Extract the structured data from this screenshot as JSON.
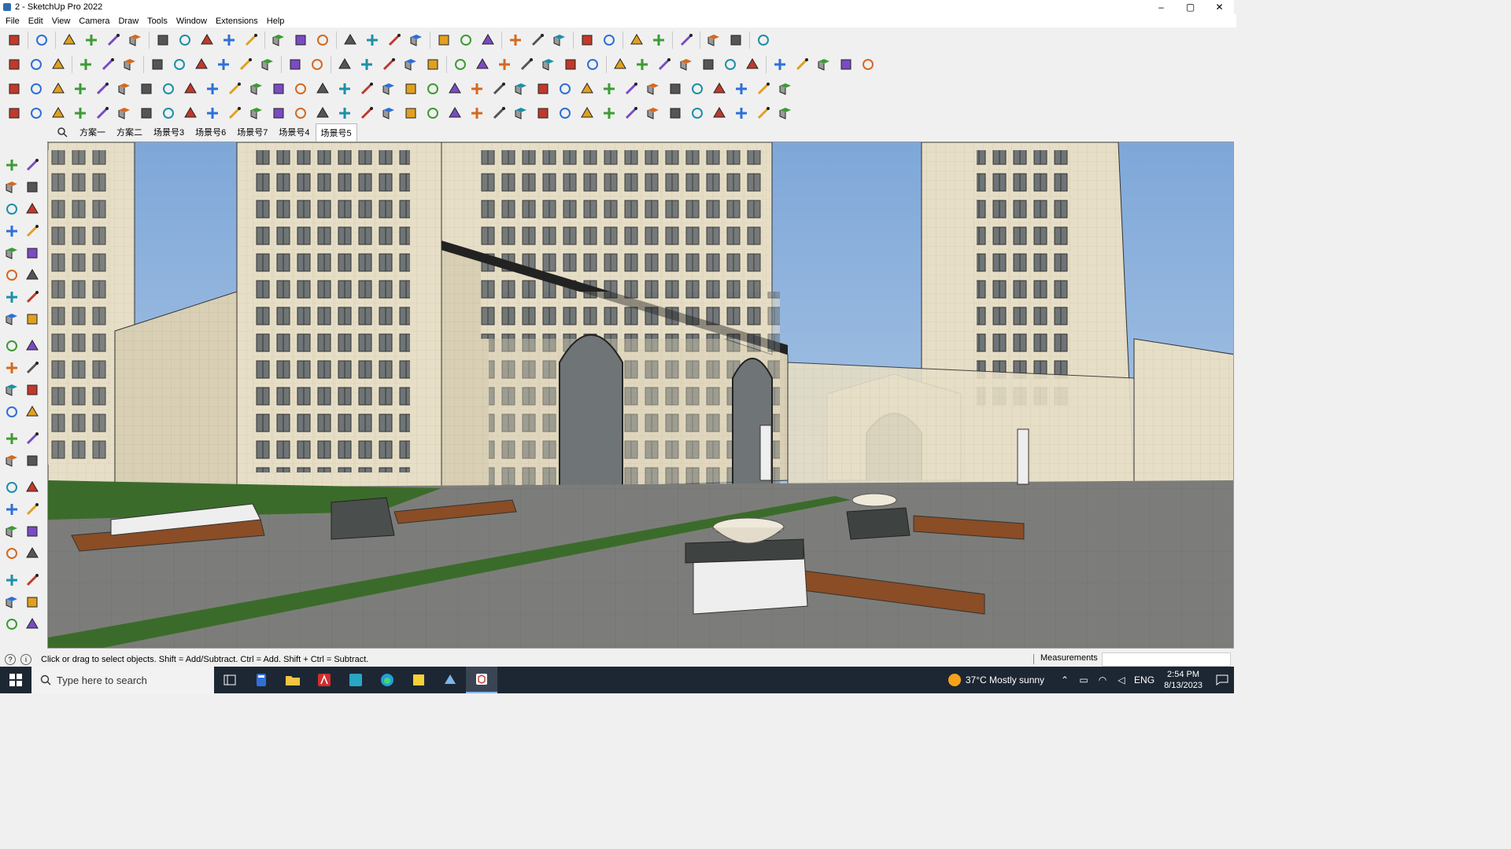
{
  "window": {
    "title": "2 - SketchUp Pro 2022",
    "controls": [
      "–",
      "▢",
      "✕"
    ]
  },
  "menu": [
    "File",
    "Edit",
    "View",
    "Camera",
    "Draw",
    "Tools",
    "Window",
    "Extensions",
    "Help"
  ],
  "scenes": {
    "tabs": [
      "方案一",
      "方案二",
      "场景号3",
      "场景号6",
      "场景号7",
      "场景号4",
      "场景号5"
    ],
    "active_index": 6
  },
  "status": {
    "hint": "Click or drag to select objects. Shift = Add/Subtract. Ctrl = Add. Shift + Ctrl = Subtract.",
    "measurements_label": "Measurements",
    "measurements_value": ""
  },
  "taskbar": {
    "search_placeholder": "Type here to search",
    "weather": "37°C  Mostly sunny",
    "language": "ENG",
    "time": "2:54 PM",
    "date": "8/13/2023"
  },
  "icon_sets": {
    "row1": [
      "search-icon",
      "select-icon",
      "eraser-icon",
      "line-icon",
      "freehand-icon",
      "rectangle-icon",
      "push-pull-icon",
      "follow-me-icon",
      "move-icon",
      "rotate-icon",
      "scale-icon",
      "tape-measure-icon",
      "text-icon",
      "paint-bucket-icon",
      "orbit-icon",
      "pan-icon",
      "zoom-icon",
      "zoom-extents-icon",
      "components-icon",
      "layers-icon",
      "styles-icon",
      "account-icon",
      "warehouse-icon",
      "extension-icon",
      "share-icon",
      "upload-icon",
      "download-icon",
      "dimension-icon",
      "section-icon",
      "undo-icon",
      "redo-icon",
      "trimble-icon"
    ],
    "row2": [
      "iso-view-icon",
      "top-view-icon",
      "front-view-icon",
      "right-view-icon",
      "back-view-icon",
      "left-view-icon",
      "wireframe-icon",
      "hidden-line-icon",
      "shaded-icon",
      "textured-icon",
      "monochrome-icon",
      "xray-icon",
      "section-plane-icon",
      "display-section-icon",
      "house-icon",
      "shed-icon",
      "home-icon",
      "outline-icon",
      "roof-icon",
      "solid-tools-icon",
      "union-icon",
      "subtract-icon",
      "trim-icon",
      "intersect-icon",
      "split-icon",
      "outer-shell-icon",
      "circle-icon",
      "polygon-icon",
      "arc-icon",
      "pie-icon",
      "offset-icon",
      "sandbox-icon",
      "contour-icon",
      "smoove-icon",
      "stamp-icon",
      "drape-icon",
      "add-detail-icon",
      "flip-edge-icon"
    ],
    "row3": [
      "plane-blue-icon",
      "plane-cyan-icon",
      "plane-yellow-icon",
      "plane-green-icon",
      "plane-red-icon",
      "plane-gray-icon",
      "loop-icon",
      "square-red-icon",
      "stairs-icon",
      "cube-small-icon",
      "chain-icon",
      "curve-icon",
      "nodes-icon",
      "cross-red-icon",
      "cross-green-icon",
      "cross-blue-icon",
      "cone-icon",
      "pyramid-icon",
      "warning-icon",
      "arc-tool-icon",
      "spiral-icon",
      "rotate-copy-icon",
      "array-icon",
      "box-icon",
      "undo-red-icon",
      "grid-green-icon",
      "knot-icon",
      "camera-icon",
      "gem-icon",
      "cog-icon",
      "bridge-icon",
      "tiles-icon",
      "frame-icon",
      "cross-dots-icon",
      "circle-dots-icon",
      "grid-icon"
    ],
    "row4": [
      "path-icon",
      "bezier-icon",
      "paint-roller-icon",
      "scissors-icon",
      "gear-icon",
      "layers-stack-icon",
      "torus-icon",
      "spring-icon",
      "corner-icon",
      "corner-alt-icon",
      "knife-icon",
      "fillet-icon",
      "column-icon",
      "colonnade-icon",
      "dome-icon",
      "vault-icon",
      "arch-icon",
      "roof-slope-icon",
      "stair-icon",
      "bench-icon",
      "truss-icon",
      "rail-icon",
      "fence-icon",
      "ramp-icon",
      "pillar-icon",
      "panel-icon",
      "wall-icon",
      "facade-icon",
      "grid-panel-icon",
      "lattice-icon",
      "slats-icon",
      "wheel-icon",
      "sunburst-icon",
      "louvre-icon",
      "fan-icon",
      "house-outline-icon"
    ],
    "left": [
      "select-arrow-icon",
      "orbit-icon",
      "paint-bucket-icon",
      "eraser-icon",
      "components-icon",
      "tape-measure-icon",
      "line-icon",
      "freehand-icon",
      "rectangle-icon",
      "rotated-rectangle-icon",
      "circle-icon",
      "polygon-icon",
      "arc-icon",
      "two-point-arc-icon",
      "three-point-arc-icon",
      "pie-icon",
      "move-icon",
      "push-pull-icon",
      "rotate-icon",
      "follow-me-icon",
      "scale-icon",
      "offset-icon",
      "tape-measure-icon",
      "dimension-icon",
      "protractor-icon",
      "text-icon",
      "axes-icon",
      "3d-text-icon",
      "orbit-tool-icon",
      "pan-icon",
      "zoom-icon",
      "zoom-window-icon",
      "zoom-extents-icon",
      "previous-view-icon",
      "position-camera-icon",
      "look-around-icon",
      "walk-icon",
      "section-plane-icon",
      "components-panel-icon",
      "styles-panel-icon",
      "layers-panel-icon",
      "shadows-icon"
    ]
  },
  "colors": {
    "accent": "#1a73e8",
    "sky": "#aac6e4",
    "facade": "#e8e0c8",
    "grass": "#3b6b2a",
    "wood": "#8a4d26",
    "paving": "#7c7d7a"
  }
}
